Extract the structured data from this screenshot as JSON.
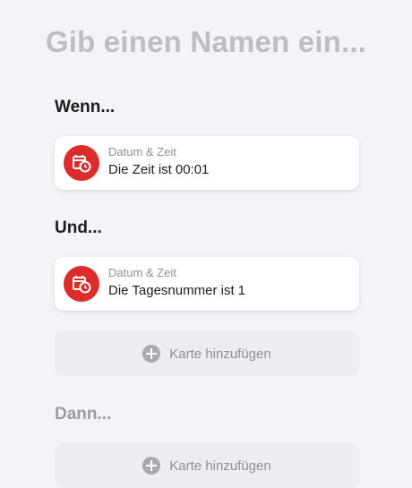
{
  "name_placeholder": "Gib einen Namen ein...",
  "sections": {
    "when": {
      "label": "Wenn...",
      "card": {
        "category": "Datum & Zeit",
        "condition": "Die Zeit ist",
        "value": "00:01",
        "icon": "calendar-clock-icon"
      }
    },
    "and": {
      "label": "Und...",
      "card": {
        "category": "Datum & Zeit",
        "condition": "Die Tagesnummer ist",
        "value": "1",
        "icon": "calendar-clock-icon"
      },
      "add_label": "Karte hinzufügen"
    },
    "then": {
      "label": "Dann...",
      "add_label": "Karte hinzufügen"
    }
  },
  "colors": {
    "accent": "#dd2c2c",
    "background": "#f4f4f8"
  }
}
